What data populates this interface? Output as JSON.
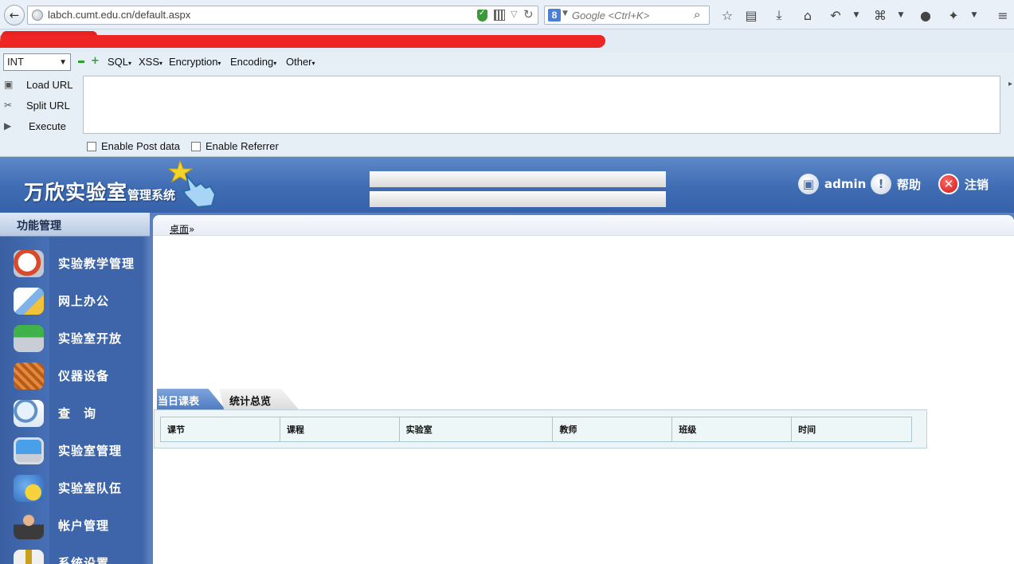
{
  "browser": {
    "url": "labch.cumt.edu.cn/default.aspx",
    "search_placeholder": "Google <Ctrl+K>",
    "search_engine_icon": "google-icon"
  },
  "hackbar": {
    "select_value": "INT",
    "menus": [
      "SQL",
      "XSS",
      "Encryption",
      "Encoding",
      "Other"
    ],
    "actions": [
      "Load URL",
      "Split URL",
      "Execute"
    ],
    "checkboxes": [
      "Enable Post data",
      "Enable Referrer"
    ]
  },
  "header": {
    "logo_main": "万欣实验室",
    "logo_sub": "管理系统",
    "user": "admin",
    "help": "帮助",
    "logout": "注销"
  },
  "sidebar": {
    "title": "功能管理",
    "items": [
      {
        "label": "实验教学管理",
        "icon": "clock-icon"
      },
      {
        "label": "网上办公",
        "icon": "notepad-icon"
      },
      {
        "label": "实验室开放",
        "icon": "download-drive-icon"
      },
      {
        "label": "仪器设备",
        "icon": "abacus-icon"
      },
      {
        "label": "查　询",
        "icon": "magnifier-icon"
      },
      {
        "label": "实验室管理",
        "icon": "monitor-icon"
      },
      {
        "label": "实验室队伍",
        "icon": "smiley-globe-icon"
      },
      {
        "label": "帐户管理",
        "icon": "person-icon"
      },
      {
        "label": "系统设置",
        "icon": "wrench-icon"
      }
    ]
  },
  "main": {
    "breadcrumb": "桌面",
    "tabs": [
      "当日课表",
      "统计总览"
    ],
    "active_tab": "当日课表",
    "table_headers": [
      "课节",
      "课程",
      "实验室",
      "教师",
      "班级",
      "时间"
    ]
  },
  "colors": {
    "header_blue": "#3f6cb3",
    "sidebar_blue": "#3e65a9",
    "redaction": "#ee2525"
  }
}
